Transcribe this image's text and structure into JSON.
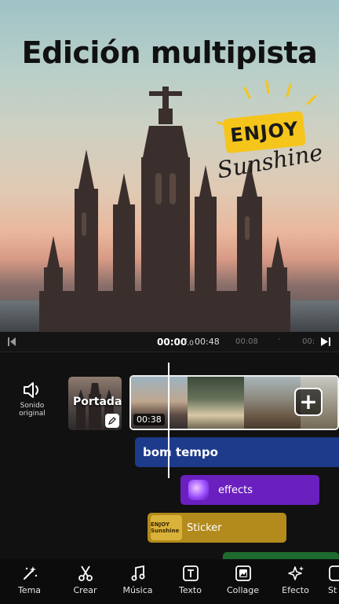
{
  "preview": {
    "title": "Edición multipista",
    "sticker_enjoy": "ENJOY",
    "sticker_sunshine": "Sunshine"
  },
  "playback": {
    "current_time_main": "00:00",
    "current_time_frac": ".0",
    "separator": "/",
    "total_time": "00:48",
    "ruler_tick_1": "00:08",
    "ruler_tick_2": "·",
    "ruler_tick_3": "00:"
  },
  "timeline": {
    "sound_label_line1": "Sonido",
    "sound_label_line2": "original",
    "cover_label": "Portada",
    "clip_duration": "00:38",
    "add_clip": "+",
    "tracks": {
      "music": "bom tempo",
      "effects": "effects",
      "sticker": "Sticker",
      "sticker_thumb": "ENJOY Sunshine"
    }
  },
  "toolbar": {
    "items": [
      {
        "label": "Tema",
        "icon": "magic-wand-icon"
      },
      {
        "label": "Crear",
        "icon": "scissors-icon"
      },
      {
        "label": "Música",
        "icon": "music-note-icon"
      },
      {
        "label": "Texto",
        "icon": "text-icon"
      },
      {
        "label": "Collage",
        "icon": "collage-icon"
      },
      {
        "label": "Efecto",
        "icon": "sparkle-icon"
      },
      {
        "label": "St",
        "icon": "sticker-icon"
      }
    ]
  },
  "colors": {
    "music_track": "#1e3a8a",
    "effects_track": "#6a1fbf",
    "sticker_track": "#b38a1c",
    "enjoy_badge": "#f5c51b"
  }
}
